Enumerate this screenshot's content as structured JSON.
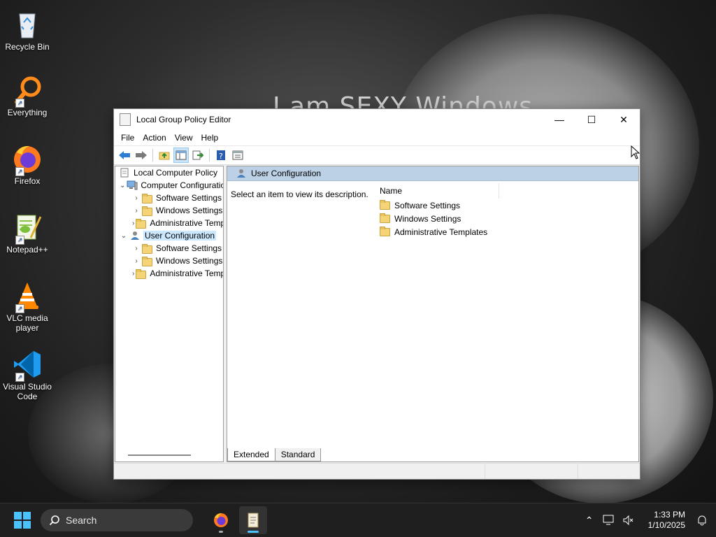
{
  "wallpaper": {
    "text": "I am SEXY Windows"
  },
  "desktop_icons": [
    {
      "label": "Recycle Bin",
      "icon": "recycle-bin-icon"
    },
    {
      "label": "Everything",
      "icon": "everything-search-icon"
    },
    {
      "label": "Firefox",
      "icon": "firefox-icon"
    },
    {
      "label": "Notepad++",
      "icon": "notepad-plus-plus-icon"
    },
    {
      "label": "VLC media player",
      "icon": "vlc-icon"
    },
    {
      "label": "Visual Studio Code",
      "icon": "vscode-icon"
    }
  ],
  "window": {
    "title": "Local Group Policy Editor",
    "controls": {
      "minimize": "—",
      "maximize": "☐",
      "close": "✕"
    },
    "menu": [
      "File",
      "Action",
      "View",
      "Help"
    ],
    "toolbar": [
      "back-arrow-icon",
      "forward-arrow-icon",
      "up-folder-icon",
      "show-hide-tree-icon",
      "export-list-icon",
      "help-icon",
      "properties-icon"
    ],
    "tree": {
      "root": "Local Computer Policy",
      "computer": {
        "label": "Computer Configuration",
        "children": [
          "Software Settings",
          "Windows Settings",
          "Administrative Templates"
        ]
      },
      "user": {
        "label": "User Configuration",
        "children": [
          "Software Settings",
          "Windows Settings",
          "Administrative Templates"
        ]
      }
    },
    "right": {
      "header": "User Configuration",
      "description": "Select an item to view its description.",
      "column_name": "Name",
      "items": [
        "Software Settings",
        "Windows Settings",
        "Administrative Templates"
      ]
    },
    "tabs": [
      "Extended",
      "Standard"
    ],
    "selected_tab": "Extended"
  },
  "taskbar": {
    "search_placeholder": "Search",
    "time": "1:33 PM",
    "date": "1/10/2025",
    "accent": "#4cc2ff"
  }
}
